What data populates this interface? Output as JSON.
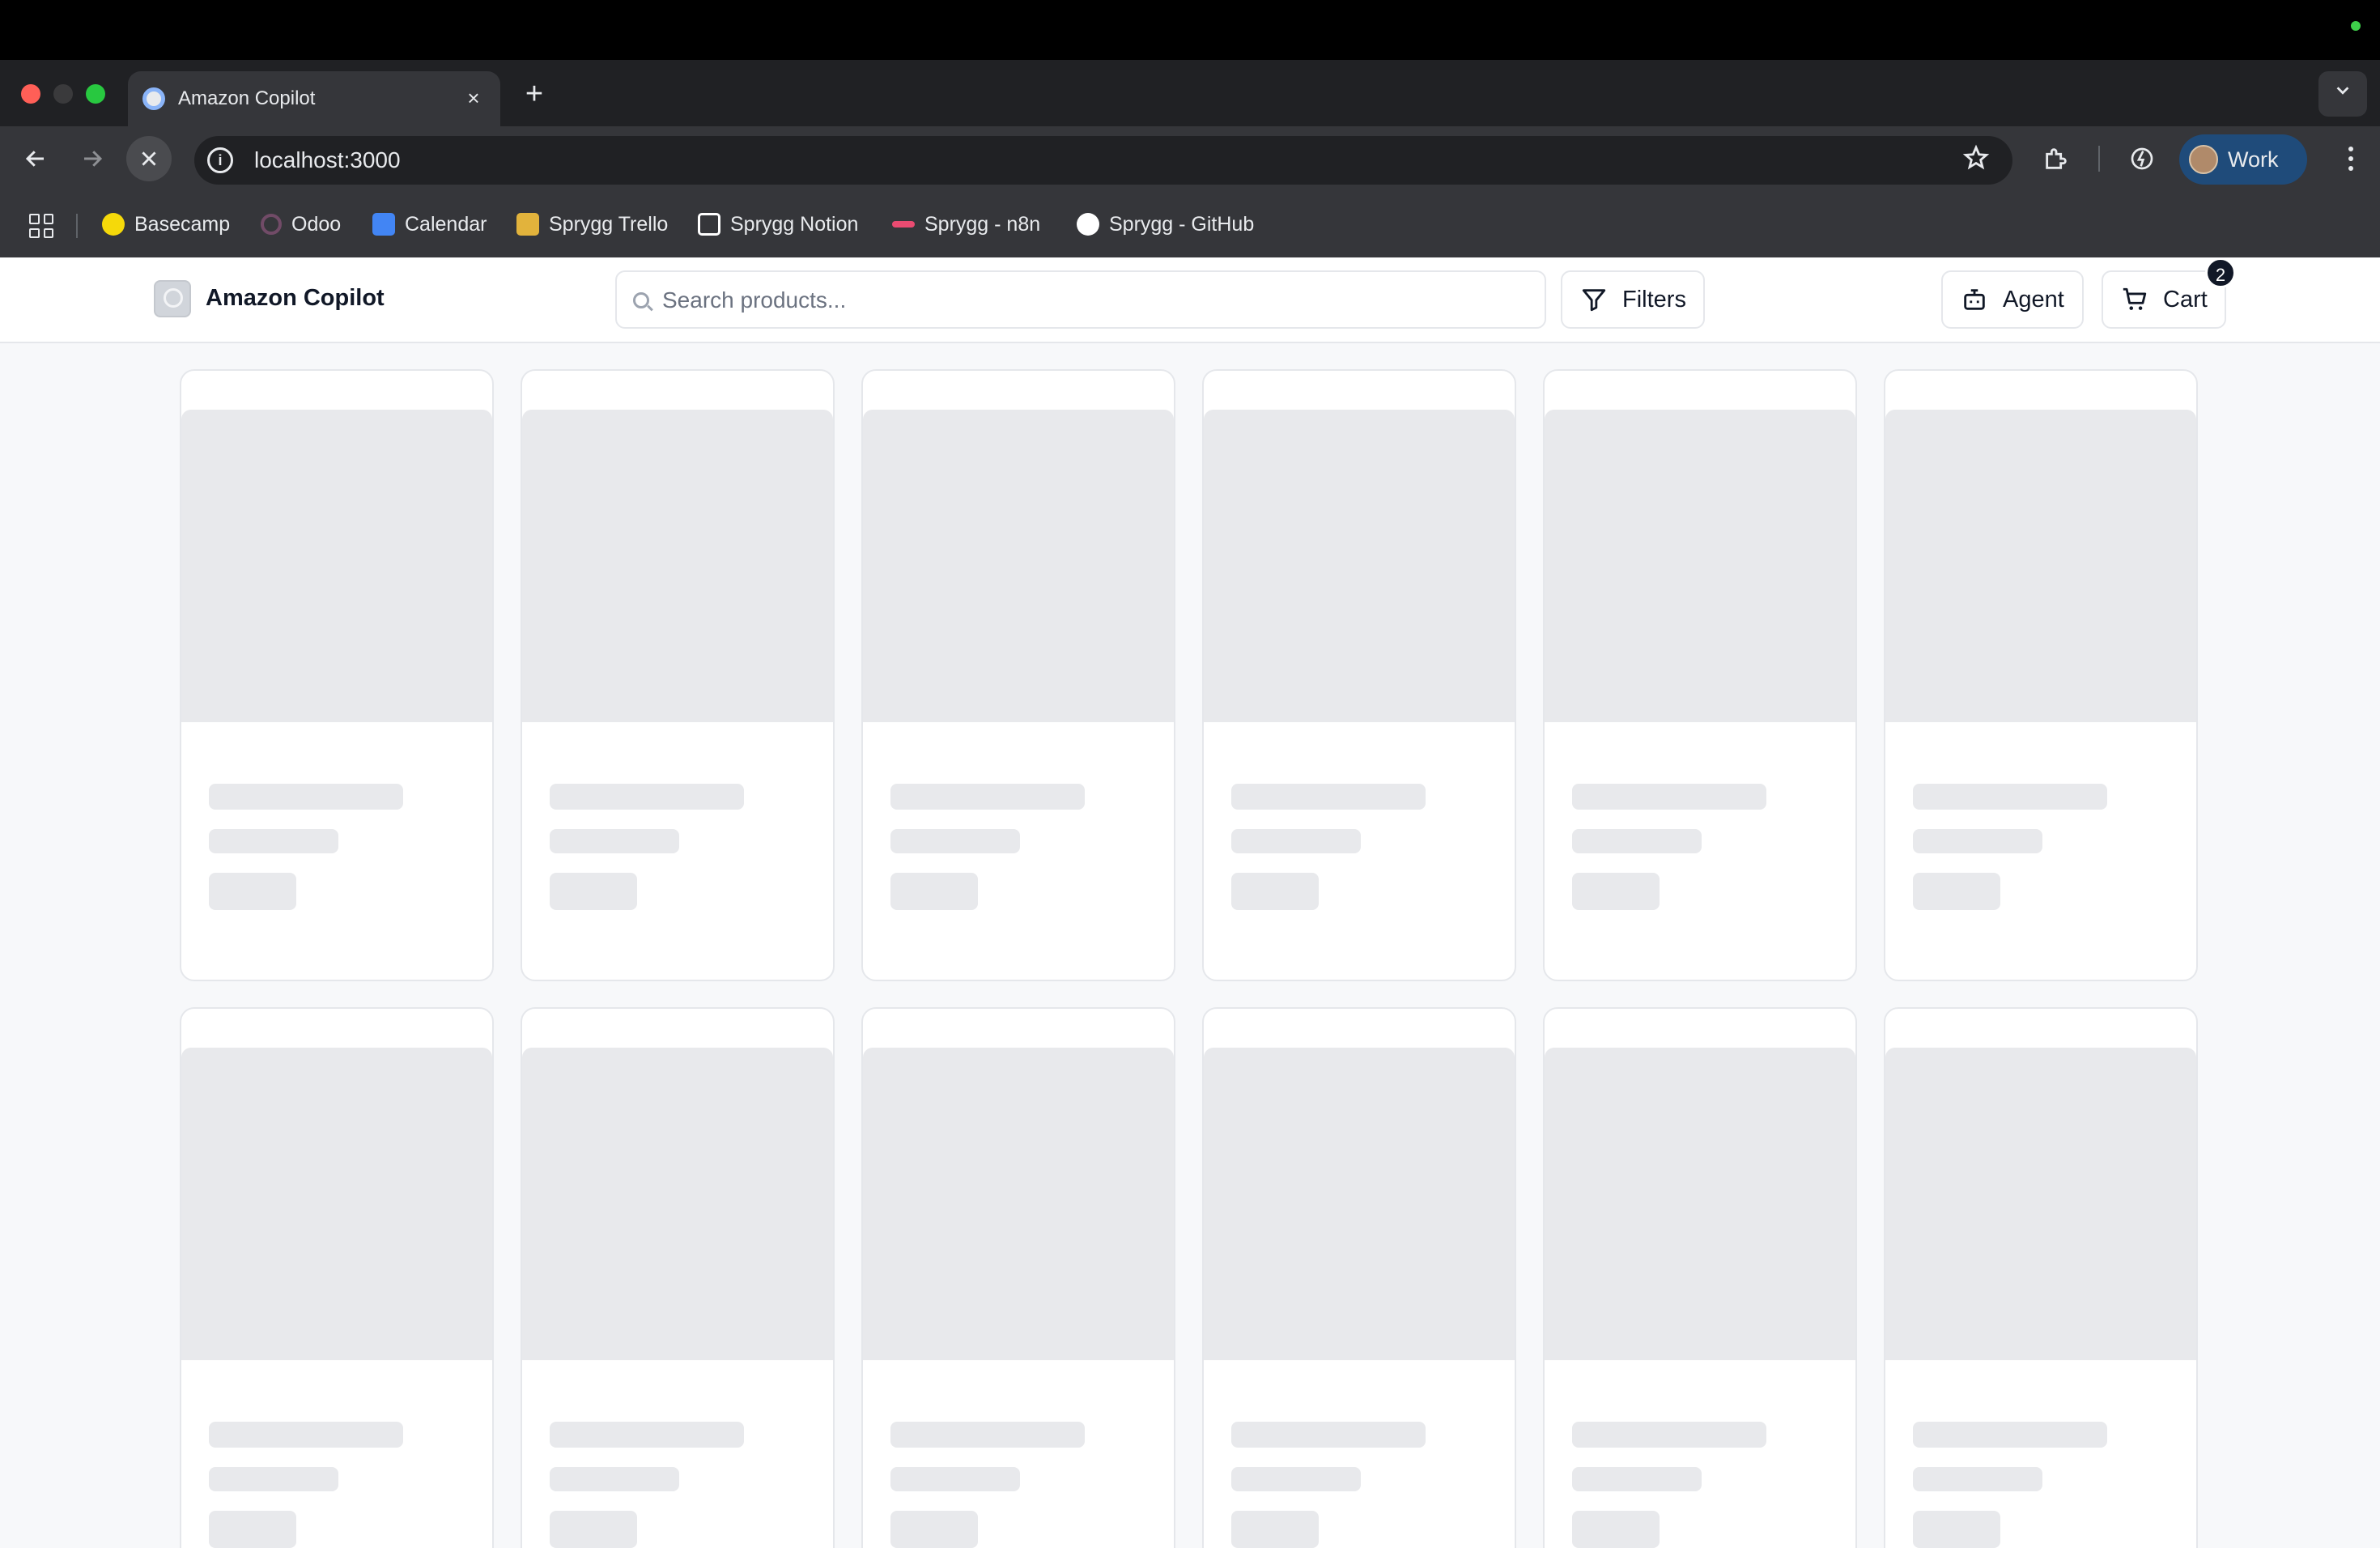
{
  "browser": {
    "tab_title": "Amazon Copilot",
    "tab_close": "×",
    "new_tab": "+",
    "url": "localhost:3000",
    "profile_label": "Work",
    "bookmarks": [
      {
        "label": "Basecamp",
        "icon": "basecamp-icon",
        "color": "#f5d90a"
      },
      {
        "label": "Odoo",
        "icon": "odoo-icon",
        "color": "#714b67"
      },
      {
        "label": "Calendar",
        "icon": "calendar-icon",
        "color": "#4285f4"
      },
      {
        "label": "Sprygg Trello",
        "icon": "trello-icon",
        "color": "#e2b33c"
      },
      {
        "label": "Sprygg Notion",
        "icon": "notion-icon",
        "color": "#ffffff"
      },
      {
        "label": "Sprygg - n8n",
        "icon": "n8n-icon",
        "color": "#ea4b71"
      },
      {
        "label": "Sprygg - GitHub",
        "icon": "github-icon",
        "color": "#ffffff"
      }
    ]
  },
  "app": {
    "brand": "Amazon Copilot",
    "search_placeholder": "Search products...",
    "filters_label": "Filters",
    "agent_label": "Agent",
    "cart_label": "Cart",
    "cart_count": "2"
  },
  "loading": {
    "skeleton_cards": 12
  }
}
